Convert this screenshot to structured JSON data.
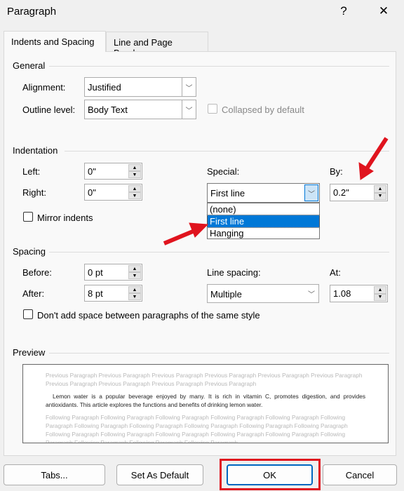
{
  "dialog": {
    "title": "Paragraph",
    "help": "?",
    "close": "✕"
  },
  "tabs": [
    {
      "label": "Indents and Spacing",
      "active": true
    },
    {
      "label": "Line and Page Breaks",
      "active": false
    }
  ],
  "general": {
    "heading": "General",
    "alignment_label": "Alignment:",
    "alignment_value": "Justified",
    "outline_label": "Outline level:",
    "outline_value": "Body Text",
    "collapsed_label": "Collapsed by default",
    "collapsed_checked": false
  },
  "indentation": {
    "heading": "Indentation",
    "left_label": "Left:",
    "left_value": "0\"",
    "right_label": "Right:",
    "right_value": "0\"",
    "special_label": "Special:",
    "special_value": "First line",
    "by_label": "By:",
    "by_value": "0.2\"",
    "mirror_label": "Mirror indents",
    "mirror_checked": false,
    "special_options": [
      {
        "label": "(none)",
        "selected": false
      },
      {
        "label": "First line",
        "selected": true
      },
      {
        "label": "Hanging",
        "selected": false
      }
    ]
  },
  "spacing": {
    "heading": "Spacing",
    "before_label": "Before:",
    "before_value": "0 pt",
    "after_label": "After:",
    "after_value": "8 pt",
    "line_spacing_label": "Line spacing:",
    "line_spacing_value": "Multiple",
    "at_label": "At:",
    "at_value": "1.08",
    "dont_add_label": "Don't add space between paragraphs of the same style",
    "dont_add_checked": false
  },
  "preview": {
    "heading": "Preview",
    "previous": "Previous Paragraph Previous Paragraph Previous Paragraph Previous Paragraph Previous Paragraph Previous Paragraph Previous Paragraph Previous Paragraph Previous Paragraph Previous Paragraph",
    "text": "Lemon water is a popular beverage enjoyed by many. It is rich in vitamin C, promotes digestion, and provides antioxidants. This article explores the functions and benefits of drinking lemon water.",
    "following": "Following Paragraph Following Paragraph Following Paragraph Following Paragraph Following Paragraph Following Paragraph Following Paragraph Following Paragraph Following Paragraph Following Paragraph Following Paragraph Following Paragraph Following Paragraph Following Paragraph Following Paragraph Following Paragraph Following Paragraph Following Paragraph Following Paragraph Following Paragraph"
  },
  "buttons": {
    "tabs": "Tabs...",
    "set_default": "Set As Default",
    "ok": "OK",
    "cancel": "Cancel"
  },
  "colors": {
    "highlight": "#0078d7",
    "annotation": "#e0141e"
  }
}
